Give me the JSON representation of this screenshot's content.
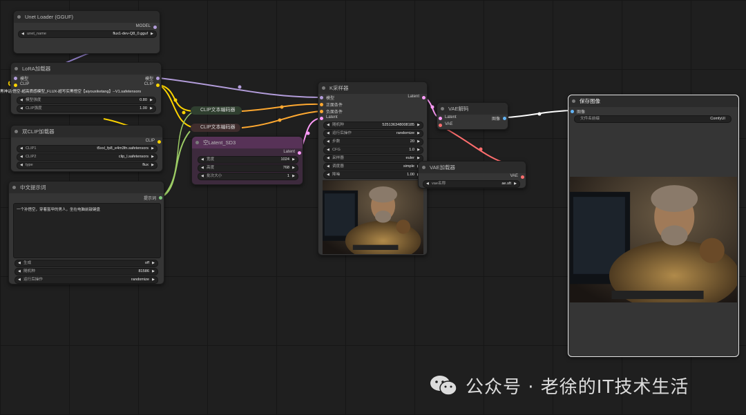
{
  "colors": {
    "model": "#b39ddb",
    "clip": "#ffd500",
    "conditioning": "#ffa931",
    "latent": "#ff9cf9",
    "vae": "#ff6e6e",
    "image": "#64b5f6",
    "string": "#7fc97f"
  },
  "unet_loader": {
    "title": "Unet Loader (GGUF)",
    "out_model": "MODEL",
    "w_unet_name": {
      "label": "unet_name",
      "value": "flux1-dev-Q8_0.gguf"
    }
  },
  "lora": {
    "title": "LoRA加载器",
    "in_model": "模型",
    "in_clip": "CLIP",
    "out_model": "模型",
    "out_clip": "CLIP",
    "lora_name": "黑神话:悟空-超高质感模型_FLUX-超写实黑悟空【aiyouxiketang】--V1.safetensors",
    "w_model_strength": {
      "label": "模型强度",
      "value": "0.80"
    },
    "w_clip_strength": {
      "label": "CLIP强度",
      "value": "1.00"
    }
  },
  "dual_clip": {
    "title": "双CLIP加载器",
    "out_clip": "CLIP",
    "w_clip1": {
      "label": "CLIP1",
      "value": "t5xxl_fp8_e4m3fn.safetensors"
    },
    "w_clip2": {
      "label": "CLIP2",
      "value": "clip_l.safetensors"
    },
    "w_type": {
      "label": "type",
      "value": "flux"
    }
  },
  "prompt_node": {
    "title": "中文提示词",
    "out_prompt": "提示词",
    "text": "一个孙悟空，穿着盔甲的男人，坐在电脑前敲键盘",
    "w_generate": {
      "label": "生成",
      "value": "off"
    },
    "w_seed": {
      "label": "随机种",
      "value": "81586"
    },
    "w_control": {
      "label": "运行后操作",
      "value": "randomize"
    }
  },
  "clip_enc1": {
    "title": "CLIP文本编码器"
  },
  "clip_enc2": {
    "title": "CLIP文本编码器"
  },
  "latent": {
    "title": "空Latent_SD3",
    "out_latent": "Latent",
    "w_width": {
      "label": "宽度",
      "value": "1024"
    },
    "w_height": {
      "label": "高度",
      "value": "768"
    },
    "w_batch": {
      "label": "批次大小",
      "value": "1"
    }
  },
  "ksampler": {
    "title": "K采样器",
    "in_model": "模型",
    "in_positive": "正面条件",
    "in_negative": "负面条件",
    "in_latent": "Latent",
    "out_latent": "Latent",
    "w_seed": {
      "label": "随机种",
      "value": "525136348008185"
    },
    "w_control": {
      "label": "运行后操作",
      "value": "randomize"
    },
    "w_steps": {
      "label": "步数",
      "value": "20"
    },
    "w_cfg": {
      "label": "CFG",
      "value": "1.0"
    },
    "w_sampler": {
      "label": "采样器",
      "value": "euler"
    },
    "w_scheduler": {
      "label": "调度器",
      "value": "simple"
    },
    "w_denoise": {
      "label": "降噪",
      "value": "1.00"
    }
  },
  "vae_decode": {
    "title": "VAE解码",
    "in_latent": "Latent",
    "in_vae": "VAE",
    "out_image": "图像"
  },
  "vae_loader": {
    "title": "VAE加载器",
    "out_vae": "VAE",
    "w_vae": {
      "label": "vae名称",
      "value": "ae.sft"
    }
  },
  "save_image": {
    "title": "保存图像",
    "in_image": "图像",
    "w_prefix": {
      "label": "文件名前缀",
      "value": "ComfyUI"
    }
  },
  "watermark": {
    "text": "公众号 · 老徐的IT技术生活"
  },
  "ui": {
    "arrow_left": "◀",
    "arrow_right": "▶"
  }
}
